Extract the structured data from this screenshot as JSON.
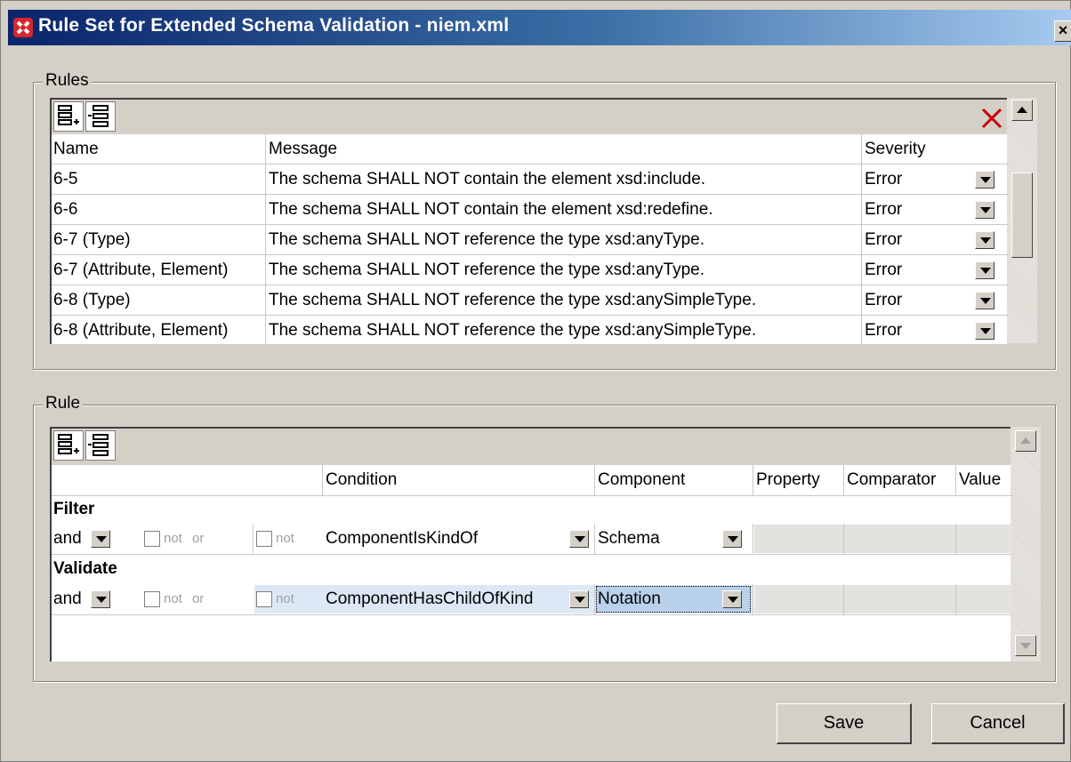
{
  "window": {
    "title": "Rule Set for Extended Schema Validation - niem.xml",
    "close_label": "×"
  },
  "rules_group": {
    "label": "Rules",
    "columns": {
      "name": "Name",
      "message": "Message",
      "severity": "Severity"
    },
    "rows": [
      {
        "name": "6-5",
        "message": "The schema SHALL NOT contain the element xsd:include.",
        "severity": "Error"
      },
      {
        "name": "6-6",
        "message": "The schema SHALL NOT contain the element xsd:redefine.",
        "severity": "Error"
      },
      {
        "name": "6-7 (Type)",
        "message": "The schema SHALL NOT reference the type xsd:anyType.",
        "severity": "Error"
      },
      {
        "name": "6-7 (Attribute, Element)",
        "message": "The schema SHALL NOT reference the type xsd:anyType.",
        "severity": "Error"
      },
      {
        "name": "6-8 (Type)",
        "message": "The schema SHALL NOT reference the type xsd:anySimpleType.",
        "severity": "Error"
      },
      {
        "name": "6-8 (Attribute, Element)",
        "message": "The schema SHALL NOT reference the type xsd:anySimpleType.",
        "severity": "Error"
      }
    ]
  },
  "rule_group": {
    "label": "Rule",
    "columns": {
      "condition": "Condition",
      "component": "Component",
      "property": "Property",
      "comparator": "Comparator",
      "value": "Value"
    },
    "sections": [
      {
        "title": "Filter",
        "op": "and",
        "not1": "not",
        "or": "or",
        "not2": "not",
        "condition": "ComponentIsKindOf",
        "component": "Schema",
        "selected": false
      },
      {
        "title": "Validate",
        "op": "and",
        "not1": "not",
        "or": "or",
        "not2": "not",
        "condition": "ComponentHasChildOfKind",
        "component": "Notation",
        "selected": true
      }
    ]
  },
  "buttons": {
    "save": "Save",
    "cancel": "Cancel"
  },
  "colors": {
    "titlebar_start": "#0a246a",
    "titlebar_end": "#a6caf0",
    "dialog_bg": "#d4d0c8",
    "selection": "#b9d1ea",
    "delete_icon": "#cc0000"
  },
  "icons": [
    "app-icon",
    "close-icon",
    "append-row-icon",
    "insert-row-icon",
    "delete-icon",
    "dropdown-arrow-icon",
    "scroll-up-icon",
    "scroll-down-icon"
  ]
}
